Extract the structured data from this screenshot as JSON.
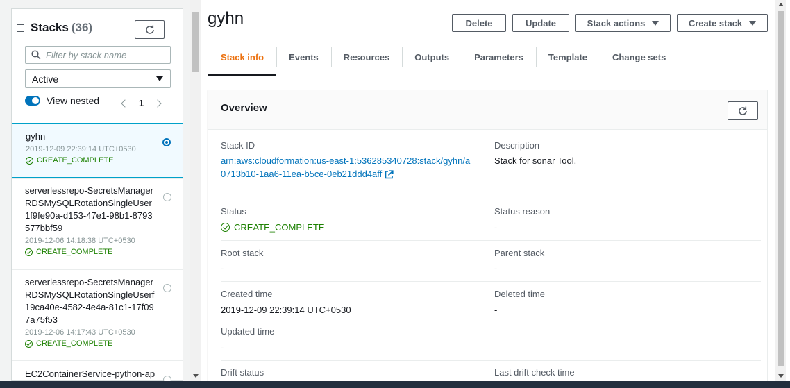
{
  "sidebar": {
    "title": "Stacks",
    "count": "(36)",
    "search_placeholder": "Filter by stack name",
    "status_filter": "Active",
    "view_nested_label": "View nested",
    "page": "1",
    "stacks": [
      {
        "name": "gyhn",
        "date": "2019-12-09 22:39:14 UTC+0530",
        "status": "CREATE_COMPLETE"
      },
      {
        "name": "serverlessrepo-SecretsManagerRDSMySQLRotationSingleUser1f9fe90a-d153-47e1-98b1-8793577bbf59",
        "date": "2019-12-06 14:18:38 UTC+0530",
        "status": "CREATE_COMPLETE"
      },
      {
        "name": "serverlessrepo-SecretsManagerRDSMySQLRotationSingleUserf19ca40e-4582-4e4a-81c1-17f097a75f53",
        "date": "2019-12-06 14:17:43 UTC+0530",
        "status": "CREATE_COMPLETE"
      },
      {
        "name": "EC2ContainerService-python-ap"
      }
    ]
  },
  "main": {
    "stack_name": "gyhn",
    "buttons": {
      "delete": "Delete",
      "update": "Update",
      "stack_actions": "Stack actions",
      "create_stack": "Create stack"
    },
    "tabs": [
      "Stack info",
      "Events",
      "Resources",
      "Outputs",
      "Parameters",
      "Template",
      "Change sets"
    ],
    "active_tab": "Stack info",
    "overview": {
      "title": "Overview",
      "stack_id_label": "Stack ID",
      "stack_id": "arn:aws:cloudformation:us-east-1:536285340728:stack/gyhn/a0713b10-1aa6-11ea-b5ce-0eb21ddd4aff",
      "description_label": "Description",
      "description": "Stack for sonar Tool.",
      "status_label": "Status",
      "status": "CREATE_COMPLETE",
      "status_reason_label": "Status reason",
      "status_reason": "-",
      "root_stack_label": "Root stack",
      "root_stack": "-",
      "parent_stack_label": "Parent stack",
      "parent_stack": "-",
      "created_time_label": "Created time",
      "created_time": "2019-12-09 22:39:14 UTC+0530",
      "deleted_time_label": "Deleted time",
      "deleted_time": "-",
      "updated_time_label": "Updated time",
      "updated_time": "-",
      "drift_status_label": "Drift status",
      "last_drift_check_label": "Last drift check time"
    }
  },
  "colors": {
    "accent_blue": "#0073bb",
    "success_green": "#1d8102",
    "active_tab_orange": "#ec7211"
  }
}
